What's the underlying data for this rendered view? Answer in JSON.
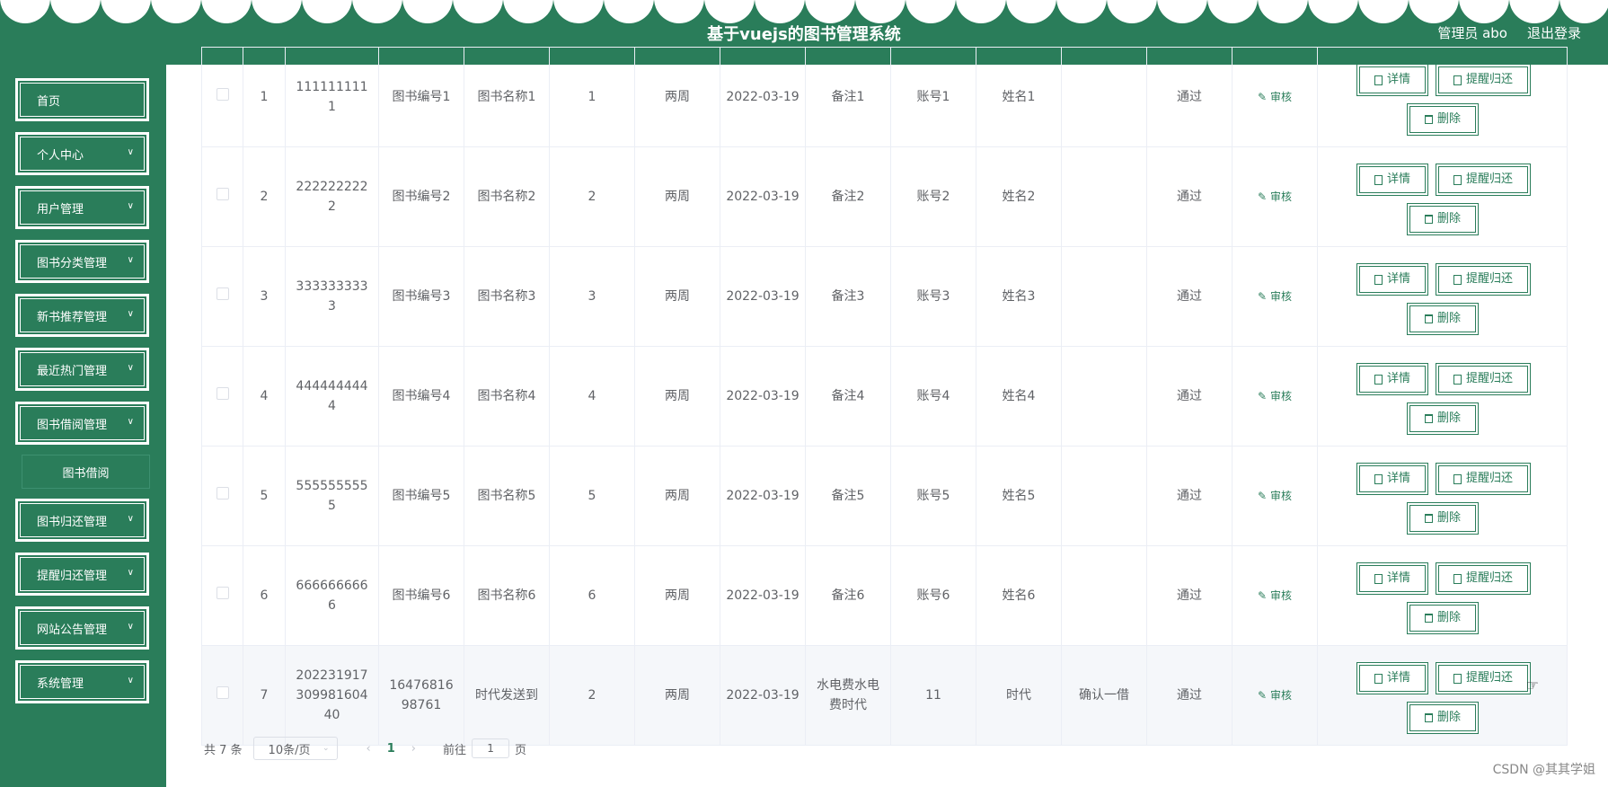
{
  "header": {
    "title": "基于vuejs的图书管理系统",
    "user_label": "管理员 abo",
    "logout_label": "退出登录"
  },
  "sidebar": {
    "items": [
      {
        "label": "首页",
        "has_arrow": false
      },
      {
        "label": "个人中心",
        "has_arrow": true
      },
      {
        "label": "用户管理",
        "has_arrow": true
      },
      {
        "label": "图书分类管理",
        "has_arrow": true
      },
      {
        "label": "新书推荐管理",
        "has_arrow": true
      },
      {
        "label": "最近热门管理",
        "has_arrow": true
      },
      {
        "label": "图书借阅管理",
        "has_arrow": true
      },
      {
        "label": "图书归还管理",
        "has_arrow": true
      },
      {
        "label": "提醒归还管理",
        "has_arrow": true
      },
      {
        "label": "网站公告管理",
        "has_arrow": true
      },
      {
        "label": "系统管理",
        "has_arrow": true
      }
    ],
    "subitem": "图书借阅"
  },
  "table": {
    "rows": [
      {
        "idx": "1",
        "code": "1111111111",
        "book_no": "图书编号1",
        "book_name": "图书名称1",
        "qty": "1",
        "period": "两周",
        "date": "2022-03-19",
        "note": "备注1",
        "account": "账号1",
        "name": "姓名1",
        "reply": "",
        "status": "通过"
      },
      {
        "idx": "2",
        "code": "2222222222",
        "book_no": "图书编号2",
        "book_name": "图书名称2",
        "qty": "2",
        "period": "两周",
        "date": "2022-03-19",
        "note": "备注2",
        "account": "账号2",
        "name": "姓名2",
        "reply": "",
        "status": "通过"
      },
      {
        "idx": "3",
        "code": "3333333333",
        "book_no": "图书编号3",
        "book_name": "图书名称3",
        "qty": "3",
        "period": "两周",
        "date": "2022-03-19",
        "note": "备注3",
        "account": "账号3",
        "name": "姓名3",
        "reply": "",
        "status": "通过"
      },
      {
        "idx": "4",
        "code": "4444444444",
        "book_no": "图书编号4",
        "book_name": "图书名称4",
        "qty": "4",
        "period": "两周",
        "date": "2022-03-19",
        "note": "备注4",
        "account": "账号4",
        "name": "姓名4",
        "reply": "",
        "status": "通过"
      },
      {
        "idx": "5",
        "code": "5555555555",
        "book_no": "图书编号5",
        "book_name": "图书名称5",
        "qty": "5",
        "period": "两周",
        "date": "2022-03-19",
        "note": "备注5",
        "account": "账号5",
        "name": "姓名5",
        "reply": "",
        "status": "通过"
      },
      {
        "idx": "6",
        "code": "6666666666",
        "book_no": "图书编号6",
        "book_name": "图书名称6",
        "qty": "6",
        "period": "两周",
        "date": "2022-03-19",
        "note": "备注6",
        "account": "账号6",
        "name": "姓名6",
        "reply": "",
        "status": "通过"
      },
      {
        "idx": "7",
        "code": "20223191730998160440",
        "book_no": "1647681698761",
        "book_name": "时代发送到",
        "qty": "2",
        "period": "两周",
        "date": "2022-03-19",
        "note": "水电费水电费时代",
        "account": "11",
        "name": "时代",
        "reply": "确认一借",
        "status": "通过"
      }
    ],
    "audit_label": "审核",
    "detail_label": "详情",
    "remind_label": "提醒归还",
    "delete_label": "删除"
  },
  "pagination": {
    "total_text": "共 7 条",
    "page_size": "10条/页",
    "current_page": "1",
    "goto_prefix": "前往",
    "goto_value": "1",
    "goto_suffix": "页"
  },
  "watermark": "CSDN @其其学姐",
  "colors": {
    "primary": "#2a7d5a",
    "row_highlight": "#f5f7fa"
  }
}
